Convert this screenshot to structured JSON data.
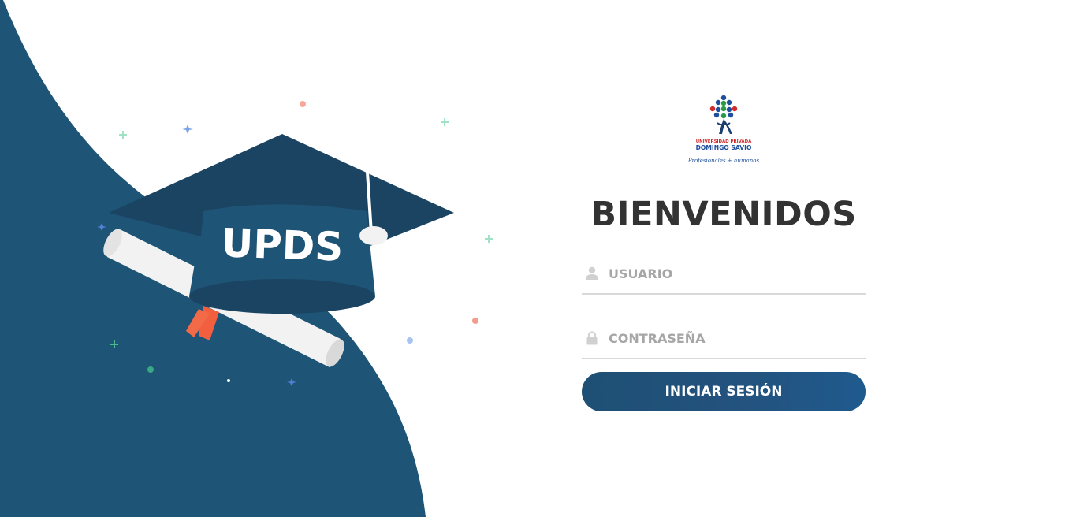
{
  "logo": {
    "line1": "UNIVERSIDAD PRIVADA",
    "line2": "DOMINGO SAVIO",
    "tagline": "Profesionales + humanos"
  },
  "hero": {
    "cap_text": "UPDS"
  },
  "login": {
    "title": "BIENVENIDOS",
    "username_placeholder": "USUARIO",
    "password_placeholder": "CONTRASEÑA",
    "submit_label": "INICIAR SESIÓN"
  },
  "icons": {
    "user": "user-icon",
    "lock": "lock-icon"
  },
  "colors": {
    "brand_blue": "#1e5475",
    "cap_dark": "#1b4462",
    "title_text": "#333333",
    "placeholder": "#a6a6a6",
    "tassel": "#f15f3e"
  }
}
